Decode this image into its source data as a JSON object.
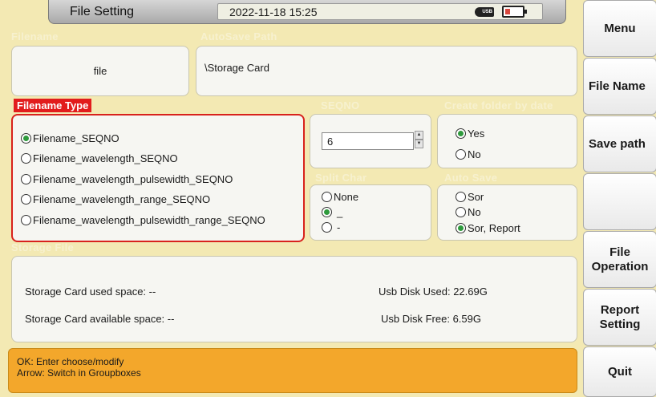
{
  "window": {
    "title": "File Setting",
    "datetime": "2022-11-18 15:25",
    "usb_label": "USB"
  },
  "filename": {
    "label": "Filename",
    "value": "file"
  },
  "autosave_path": {
    "label": "AutoSave Path",
    "value": "\\Storage Card"
  },
  "filename_type": {
    "label": "Filename Type",
    "options": [
      {
        "label": "Filename_SEQNO",
        "selected": true
      },
      {
        "label": "Filename_wavelength_SEQNO",
        "selected": false
      },
      {
        "label": "Filename_wavelength_pulsewidth_SEQNO",
        "selected": false
      },
      {
        "label": "Filename_wavelength_range_SEQNO",
        "selected": false
      },
      {
        "label": "Filename_wavelength_pulsewidth_range_SEQNO",
        "selected": false
      }
    ]
  },
  "seqno": {
    "label": "SEQNO",
    "value": "6"
  },
  "create_folder": {
    "label": "Create folder by date",
    "options": [
      {
        "label": "Yes",
        "selected": true
      },
      {
        "label": "No",
        "selected": false
      }
    ]
  },
  "split_char": {
    "label": "Split Char",
    "options": [
      {
        "label": "None",
        "selected": false
      },
      {
        "label": "_",
        "selected": true
      },
      {
        "label": "-",
        "selected": false
      }
    ]
  },
  "auto_save": {
    "label": "Auto Save",
    "options": [
      {
        "label": "Sor",
        "selected": false
      },
      {
        "label": "No",
        "selected": false
      },
      {
        "label": "Sor, Report",
        "selected": true
      }
    ]
  },
  "storage_file": {
    "label": "Storage File",
    "card_used": "Storage Card used space: --",
    "card_available": "Storage Card available space: --",
    "usb_used": "Usb Disk Used: 22.69G",
    "usb_free": "Usb Disk Free: 6.59G"
  },
  "status": {
    "line1": "OK: Enter choose/modify",
    "line2": "Arrow: Switch in Groupboxes"
  },
  "side_menu": {
    "menu": "Menu",
    "file_name": "File Name",
    "save_path": "Save path",
    "empty": "",
    "file_operation": "File Operation",
    "report_setting": "Report Setting",
    "quit": "Quit"
  },
  "colors": {
    "background": "#f3e9b3",
    "accent_red": "#e21c1c",
    "status_orange": "#f3a72b",
    "radio_selected": "#2e9a3c"
  }
}
